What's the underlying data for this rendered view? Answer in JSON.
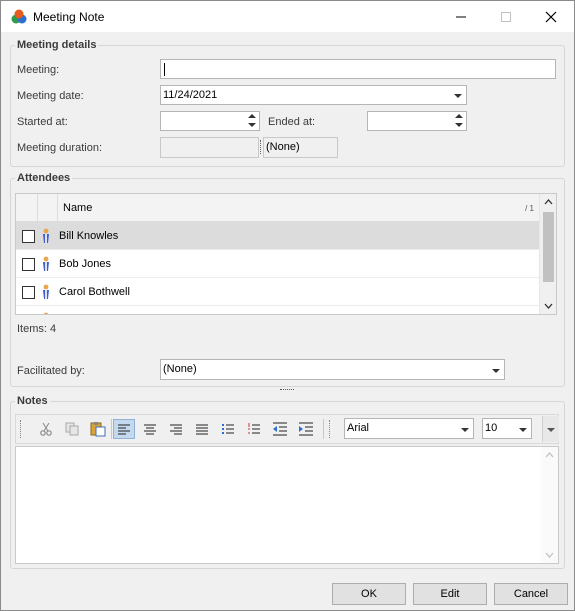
{
  "window": {
    "title": "Meeting Note"
  },
  "meeting_details": {
    "title": "Meeting details",
    "meeting_label": "Meeting:",
    "meeting_value": "",
    "date_label": "Meeting date:",
    "date_value": "11/24/2021",
    "started_label": "Started at:",
    "started_value": "",
    "ended_label": "Ended at:",
    "ended_value": "",
    "duration_label": "Meeting duration:",
    "duration_value": "(None)"
  },
  "attendees": {
    "title": "Attendees",
    "column_name": "Name",
    "sort_indicator": "/ 1",
    "rows": [
      {
        "name": "Bill Knowles",
        "checked": false,
        "selected": true
      },
      {
        "name": "Bob Jones",
        "checked": false,
        "selected": false
      },
      {
        "name": "Carol Bothwell",
        "checked": false,
        "selected": false
      }
    ],
    "items_count": "Items: 4",
    "facilitated_label": "Facilitated by:",
    "facilitated_value": "(None)"
  },
  "notes": {
    "title": "Notes",
    "font_name": "Arial",
    "font_size": "10",
    "toolbar_icons": [
      "cut-icon",
      "copy-icon",
      "paste-icon",
      "align-left-icon",
      "align-center-icon",
      "align-right-icon",
      "justify-icon",
      "bullet-list-icon",
      "numbered-list-icon",
      "outdent-icon",
      "indent-icon"
    ]
  },
  "footer": {
    "ok": "OK",
    "edit": "Edit",
    "cancel": "Cancel"
  },
  "colors": {
    "selected_row": "#dcdcdc",
    "active_toolbar": "#c4d9ee",
    "panel_bg": "#f0f0f0"
  }
}
